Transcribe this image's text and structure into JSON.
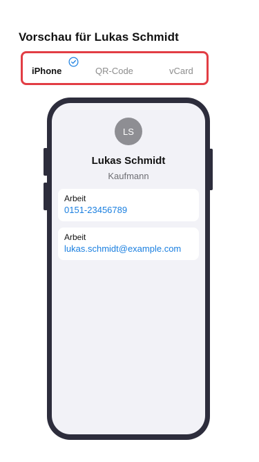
{
  "heading": "Vorschau für Lukas Schmidt",
  "tabs": [
    {
      "label": "iPhone",
      "active": true
    },
    {
      "label": "QR-Code",
      "active": false
    },
    {
      "label": "vCard",
      "active": false
    }
  ],
  "contact": {
    "initials": "LS",
    "name": "Lukas Schmidt",
    "title": "Kaufmann",
    "fields": [
      {
        "label": "Arbeit",
        "value": "0151-23456789"
      },
      {
        "label": "Arbeit",
        "value": "lukas.schmidt@example.com"
      }
    ]
  },
  "colors": {
    "highlight_border": "#e23d44",
    "link": "#1a7fe0",
    "check_icon": "#1a7fe0",
    "phone_frame": "#2d2d3c",
    "avatar": "#8e8e93"
  },
  "icons": {
    "active_tab_indicator": "check-circle-icon"
  }
}
